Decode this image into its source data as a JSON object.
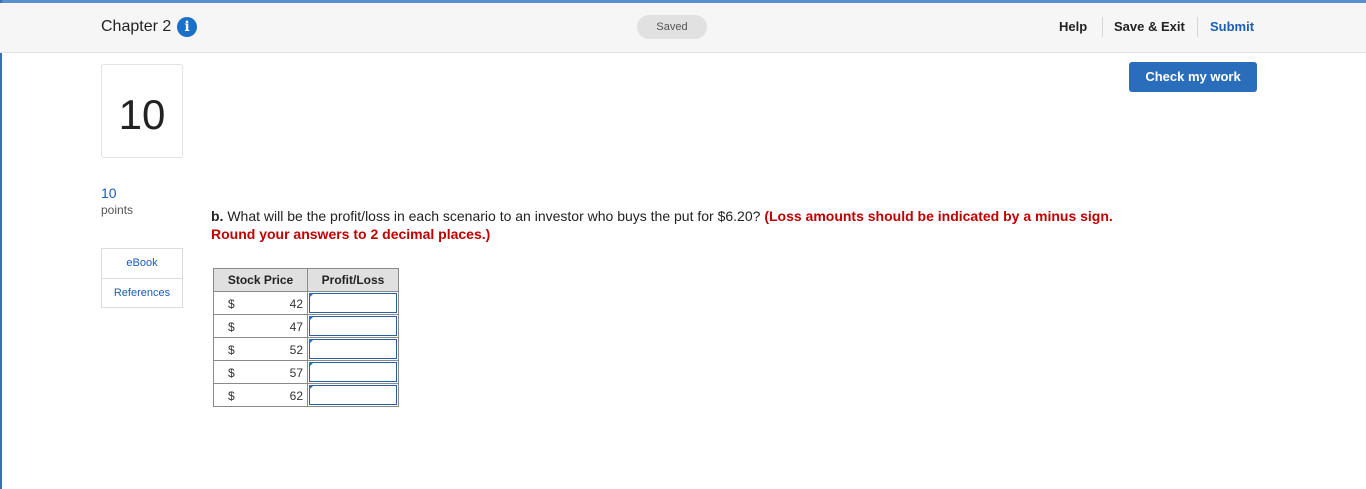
{
  "header": {
    "chapter_title": "Chapter 2",
    "info_icon": "info-icon",
    "saved_status": "Saved",
    "help_label": "Help",
    "save_exit_label": "Save & Exit",
    "submit_label": "Submit"
  },
  "question": {
    "number": "10",
    "points_value": "10",
    "points_label": "points",
    "check_button_label": "Check my work",
    "ebook_label": "eBook",
    "references_label": "References",
    "lead": "b.",
    "text": " What will be the profit/loss in each scenario to an investor who buys the put for $6.20? ",
    "instructions": "(Loss amounts should be indicated by a minus sign. Round your answers to 2 decimal places.)"
  },
  "table": {
    "headers": [
      "Stock Price",
      "Profit/Loss"
    ],
    "currency_symbol": "$",
    "rows": [
      {
        "price": "42",
        "profit_loss": ""
      },
      {
        "price": "47",
        "profit_loss": ""
      },
      {
        "price": "52",
        "profit_loss": ""
      },
      {
        "price": "57",
        "profit_loss": ""
      },
      {
        "price": "62",
        "profit_loss": ""
      }
    ]
  },
  "colors": {
    "accent": "#2a6ebb",
    "instruction_red": "#c00000"
  }
}
